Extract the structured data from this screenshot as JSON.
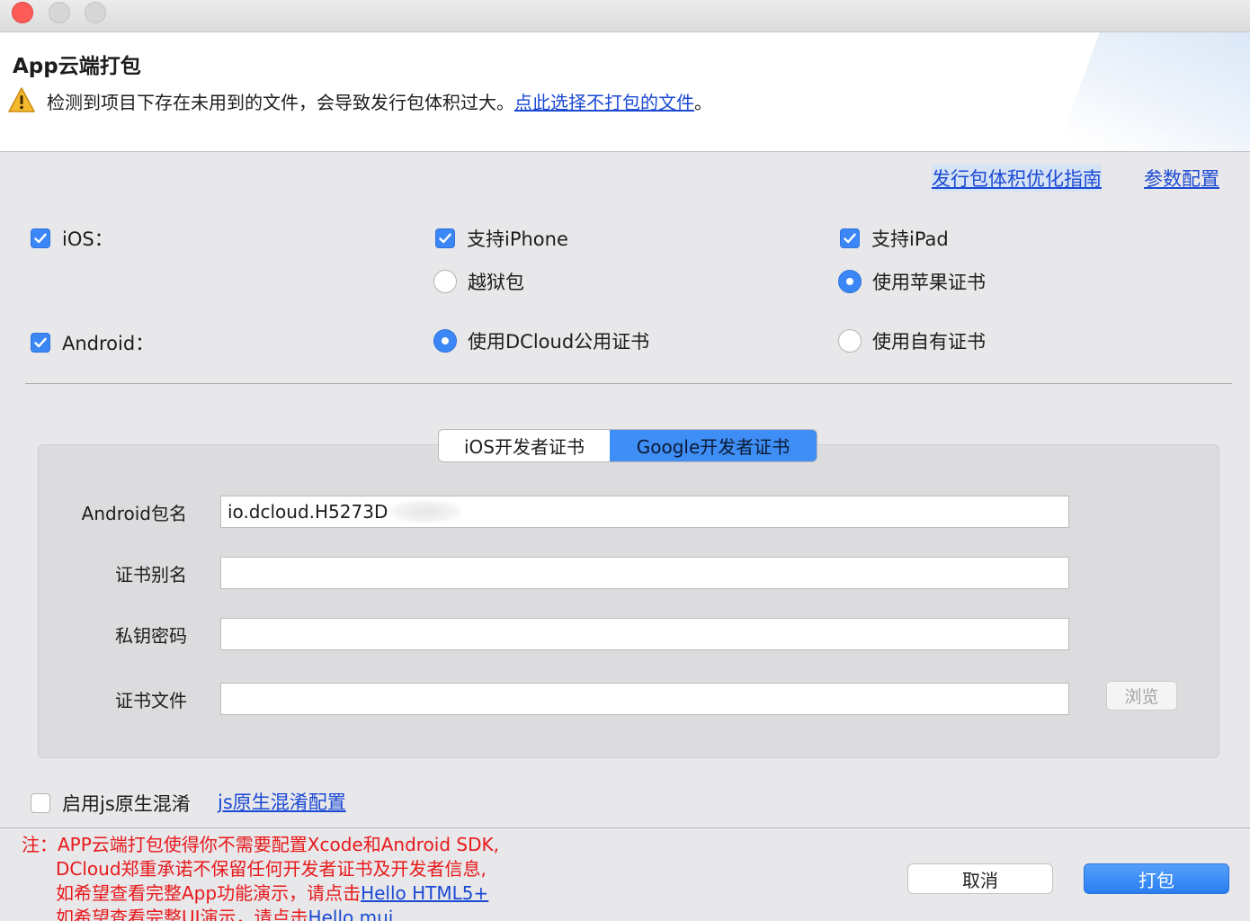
{
  "window": {
    "title": "App云端打包"
  },
  "warning": {
    "text": "检测到项目下存在未用到的文件，会导致发行包体积过大。",
    "link": "点此选择不打包的文件",
    "suffix": "。"
  },
  "toplinks": {
    "guide": "发行包体积优化指南",
    "params": "参数配置"
  },
  "ios": {
    "label": "iOS：",
    "checked": true,
    "support_iphone": "支持iPhone",
    "support_ipad": "支持iPad",
    "jailbreak": "越狱包",
    "apple_cert": "使用苹果证书",
    "selected_cert": "使用苹果证书"
  },
  "android": {
    "label": "Android：",
    "checked": true,
    "dcloud_cert": "使用DCloud公用证书",
    "own_cert": "使用自有证书",
    "selected_cert": "使用DCloud公用证书"
  },
  "tabs": {
    "ios": "iOS开发者证书",
    "google": "Google开发者证书",
    "active": "Google开发者证书"
  },
  "form": {
    "package_name_label": "Android包名",
    "package_name_value": "io.dcloud.H5273D",
    "alias_label": "证书别名",
    "alias_value": "",
    "password_label": "私钥密码",
    "password_value": "",
    "file_label": "证书文件",
    "file_value": "",
    "browse": "浏览"
  },
  "obfuscation": {
    "label": "启用js原生混淆",
    "checked": false,
    "link": "js原生混淆配置"
  },
  "note": {
    "line1": "注：APP云端打包使得你不需要配置Xcode和Android SDK,",
    "line2": "DCloud郑重承诺不保留任何开发者证书及开发者信息,",
    "line3": "如希望查看完整App功能演示，请点击",
    "line3_link": "Hello HTML5+",
    "line4": "如希望查看完整UI演示，请点击",
    "line4_link": "Hello mui"
  },
  "buttons": {
    "cancel": "取消",
    "ok": "打包"
  },
  "colors": {
    "accent": "#3b87f6",
    "link": "#1a49d4",
    "note": "#e8191b"
  }
}
